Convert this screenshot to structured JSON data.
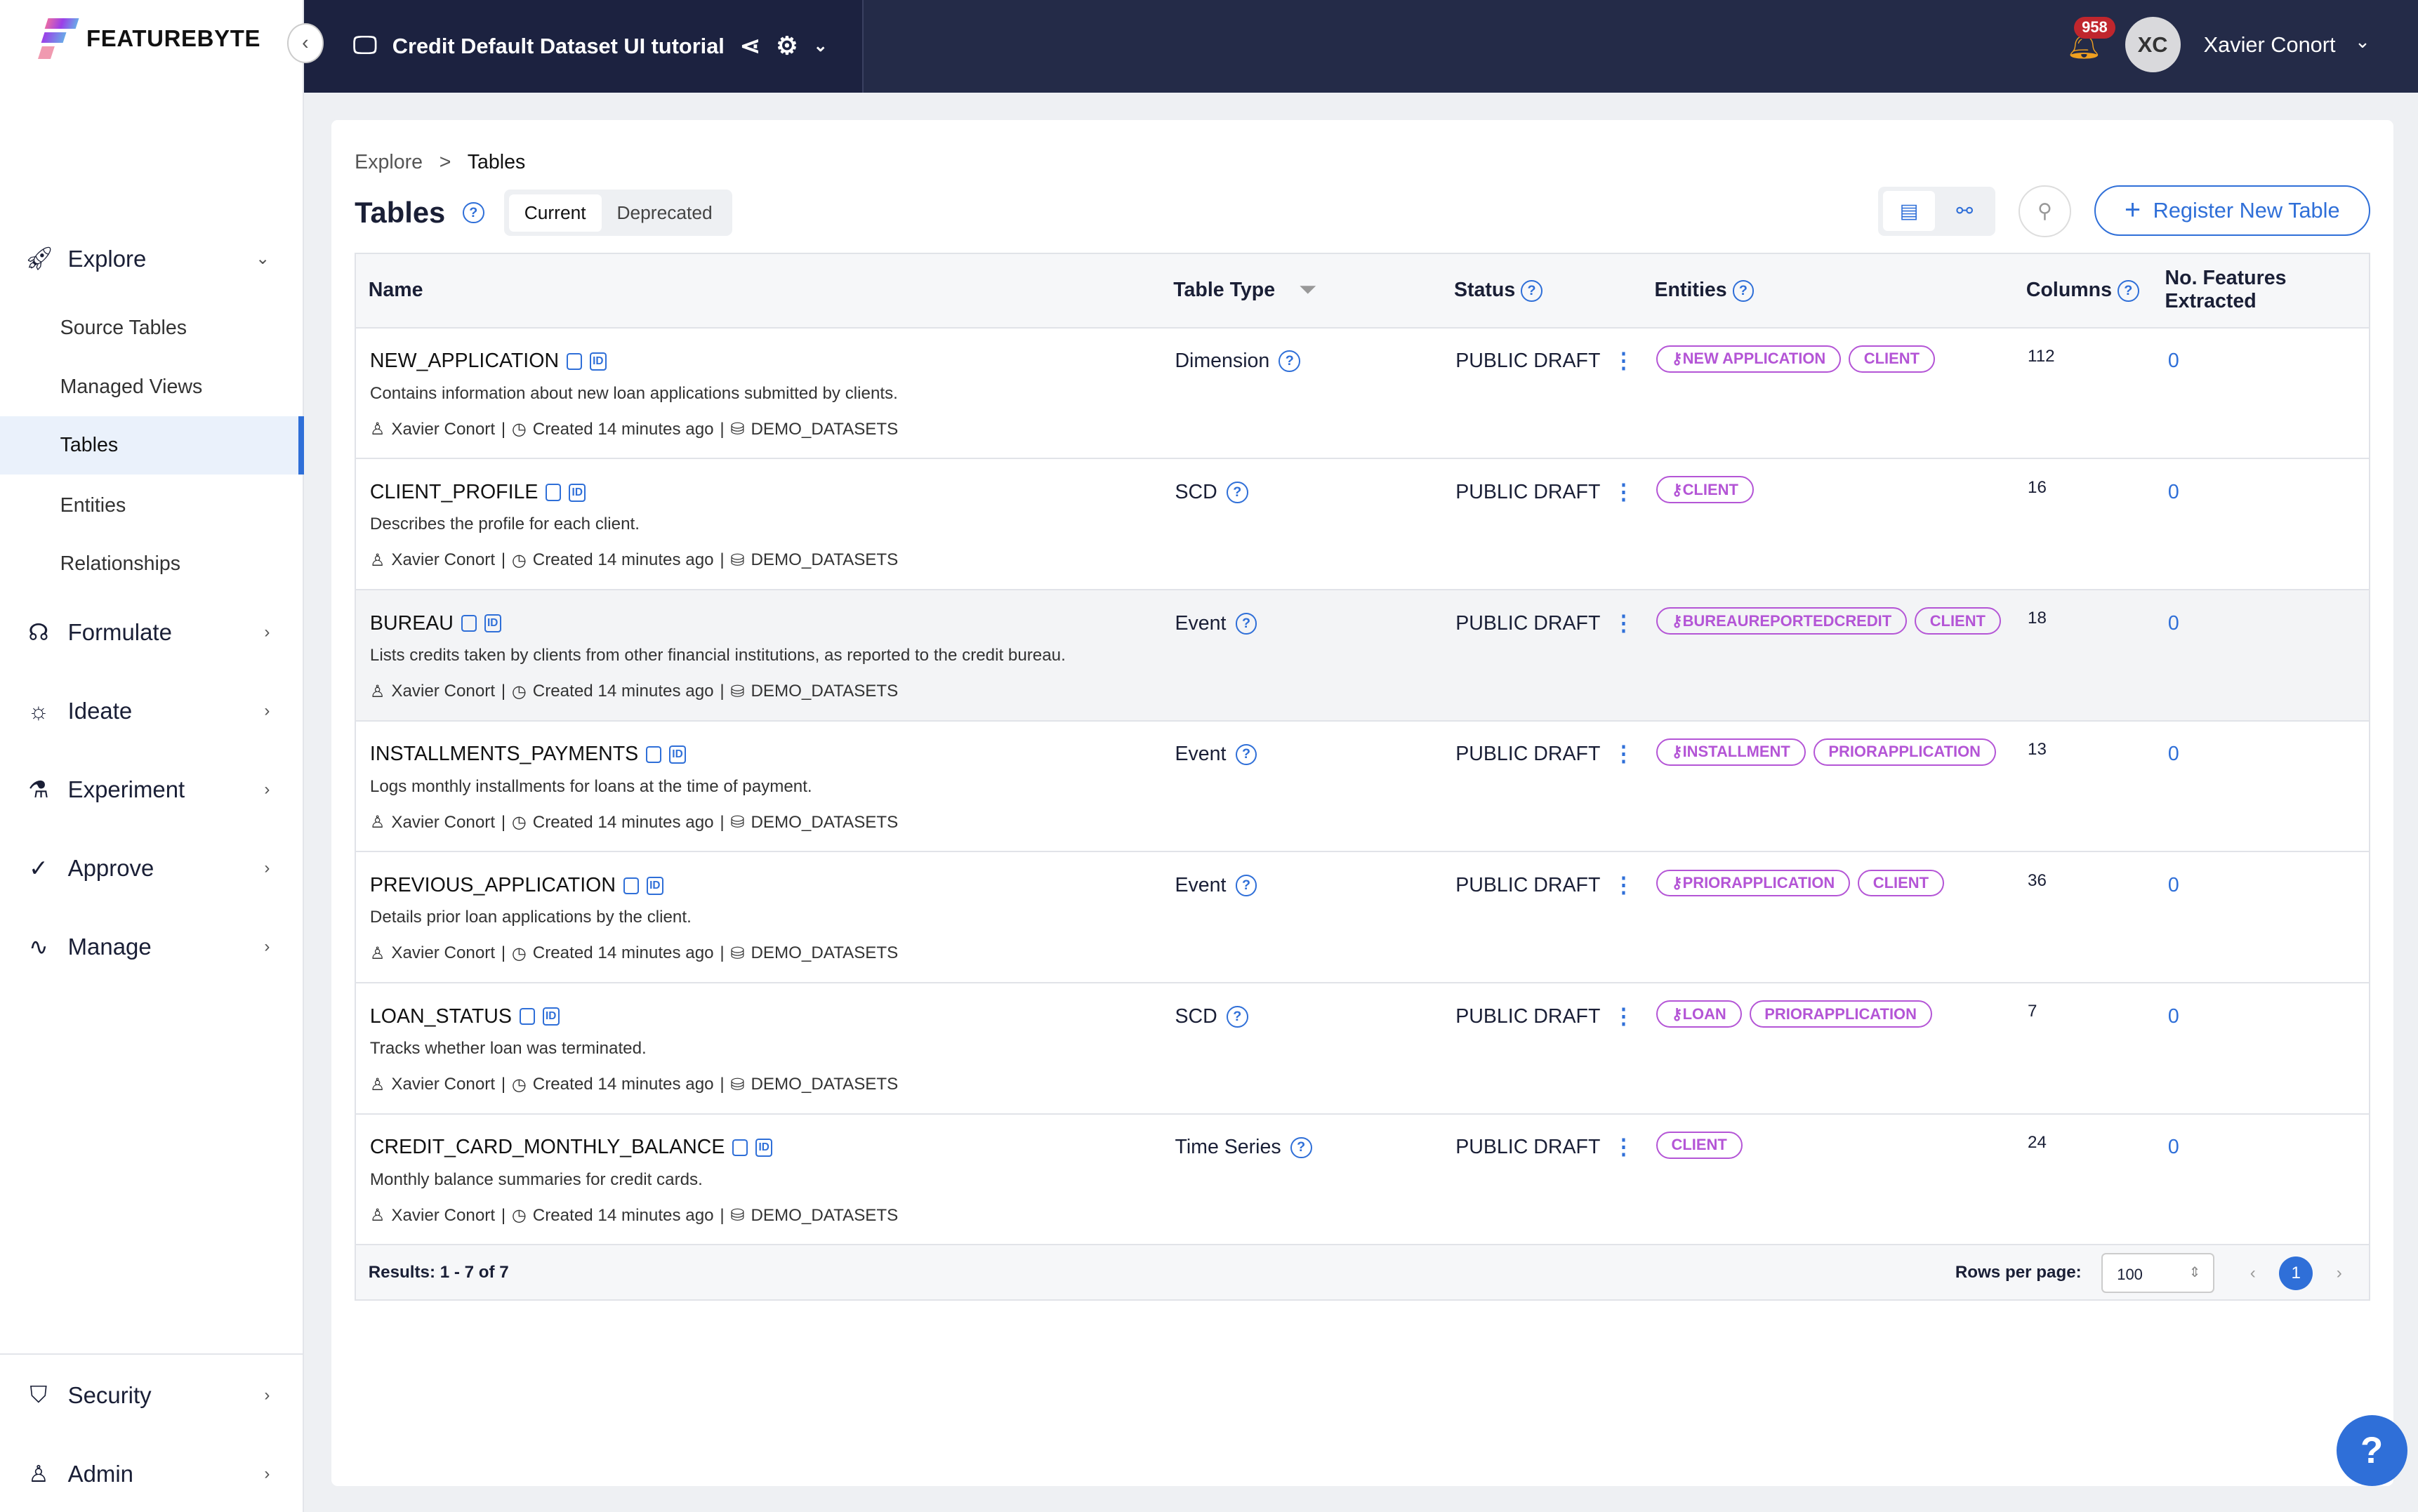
{
  "brand": {
    "name": "FEATUREBYTE"
  },
  "topbar": {
    "project_title": "Credit Default Dataset UI tutorial",
    "notification_count": "958",
    "user_initials": "XC",
    "user_name": "Xavier Conort"
  },
  "sidebar": {
    "explore": {
      "label": "Explore",
      "items": [
        {
          "label": "Source Tables"
        },
        {
          "label": "Managed Views"
        },
        {
          "label": "Tables",
          "active": true
        },
        {
          "label": "Entities"
        },
        {
          "label": "Relationships"
        }
      ]
    },
    "sections": [
      {
        "label": "Formulate",
        "icon": "brain-icon"
      },
      {
        "label": "Ideate",
        "icon": "lightbulb-icon"
      },
      {
        "label": "Experiment",
        "icon": "flask-icon"
      },
      {
        "label": "Approve",
        "icon": "check-icon"
      },
      {
        "label": "Manage",
        "icon": "pulse-icon"
      }
    ],
    "bottom": [
      {
        "label": "Security",
        "icon": "shield-icon"
      },
      {
        "label": "Admin",
        "icon": "user-gear-icon"
      }
    ]
  },
  "breadcrumb": [
    "Explore",
    ">",
    "Tables"
  ],
  "page": {
    "title": "Tables",
    "tabs": [
      {
        "label": "Current",
        "active": true
      },
      {
        "label": "Deprecated"
      }
    ],
    "register_label": "Register New Table"
  },
  "table": {
    "headers": {
      "name": "Name",
      "table_type": "Table Type",
      "status": "Status",
      "entities": "Entities",
      "columns": "Columns",
      "features": "No. Features Extracted"
    },
    "rows": [
      {
        "name": "NEW_APPLICATION",
        "description": "Contains information about new loan applications submitted by clients.",
        "owner": "Xavier Conort",
        "created": "Created 14 minutes ago",
        "source": "DEMO_DATASETS",
        "type": "Dimension",
        "status": "PUBLIC DRAFT",
        "entities": [
          {
            "name": "NEW APPLICATION",
            "primary": true
          },
          {
            "name": "CLIENT",
            "primary": false
          }
        ],
        "columns": "112",
        "features": "0"
      },
      {
        "name": "CLIENT_PROFILE",
        "description": "Describes the profile for each client.",
        "owner": "Xavier Conort",
        "created": "Created 14 minutes ago",
        "source": "DEMO_DATASETS",
        "type": "SCD",
        "status": "PUBLIC DRAFT",
        "entities": [
          {
            "name": "CLIENT",
            "primary": true
          }
        ],
        "columns": "16",
        "features": "0"
      },
      {
        "name": "BUREAU",
        "description": "Lists credits taken by clients from other financial institutions, as reported to the credit bureau.",
        "owner": "Xavier Conort",
        "created": "Created 14 minutes ago",
        "source": "DEMO_DATASETS",
        "type": "Event",
        "status": "PUBLIC DRAFT",
        "entities": [
          {
            "name": "BUREAUREPORTEDCREDIT",
            "primary": true
          },
          {
            "name": "CLIENT",
            "primary": false
          }
        ],
        "columns": "18",
        "features": "0",
        "hovered": true
      },
      {
        "name": "INSTALLMENTS_PAYMENTS",
        "description": "Logs monthly installments for loans at the time of payment.",
        "owner": "Xavier Conort",
        "created": "Created 14 minutes ago",
        "source": "DEMO_DATASETS",
        "type": "Event",
        "status": "PUBLIC DRAFT",
        "entities": [
          {
            "name": "INSTALLMENT",
            "primary": true
          },
          {
            "name": "PRIORAPPLICATION",
            "primary": false
          }
        ],
        "columns": "13",
        "features": "0"
      },
      {
        "name": "PREVIOUS_APPLICATION",
        "description": "Details prior loan applications by the client.",
        "owner": "Xavier Conort",
        "created": "Created 14 minutes ago",
        "source": "DEMO_DATASETS",
        "type": "Event",
        "status": "PUBLIC DRAFT",
        "entities": [
          {
            "name": "PRIORAPPLICATION",
            "primary": true
          },
          {
            "name": "CLIENT",
            "primary": false
          }
        ],
        "columns": "36",
        "features": "0"
      },
      {
        "name": "LOAN_STATUS",
        "description": "Tracks whether loan was terminated.",
        "owner": "Xavier Conort",
        "created": "Created 14 minutes ago",
        "source": "DEMO_DATASETS",
        "type": "SCD",
        "status": "PUBLIC DRAFT",
        "entities": [
          {
            "name": "LOAN",
            "primary": true
          },
          {
            "name": "PRIORAPPLICATION",
            "primary": false
          }
        ],
        "columns": "7",
        "features": "0"
      },
      {
        "name": "CREDIT_CARD_MONTHLY_BALANCE",
        "description": "Monthly balance summaries for credit cards.",
        "owner": "Xavier Conort",
        "created": "Created 14 minutes ago",
        "source": "DEMO_DATASETS",
        "type": "Time Series",
        "status": "PUBLIC DRAFT",
        "entities": [
          {
            "name": "CLIENT",
            "primary": false
          }
        ],
        "columns": "24",
        "features": "0"
      }
    ],
    "footer": {
      "results": "Results: 1 - 7 of 7",
      "rows_per_page_label": "Rows per page:",
      "rows_per_page": "100",
      "current_page": "1"
    }
  },
  "colors": {
    "accent": "#2f6fd8",
    "entity_pill": "#b455d6",
    "topbar": "#1c2240",
    "notification": "#c0262d"
  }
}
